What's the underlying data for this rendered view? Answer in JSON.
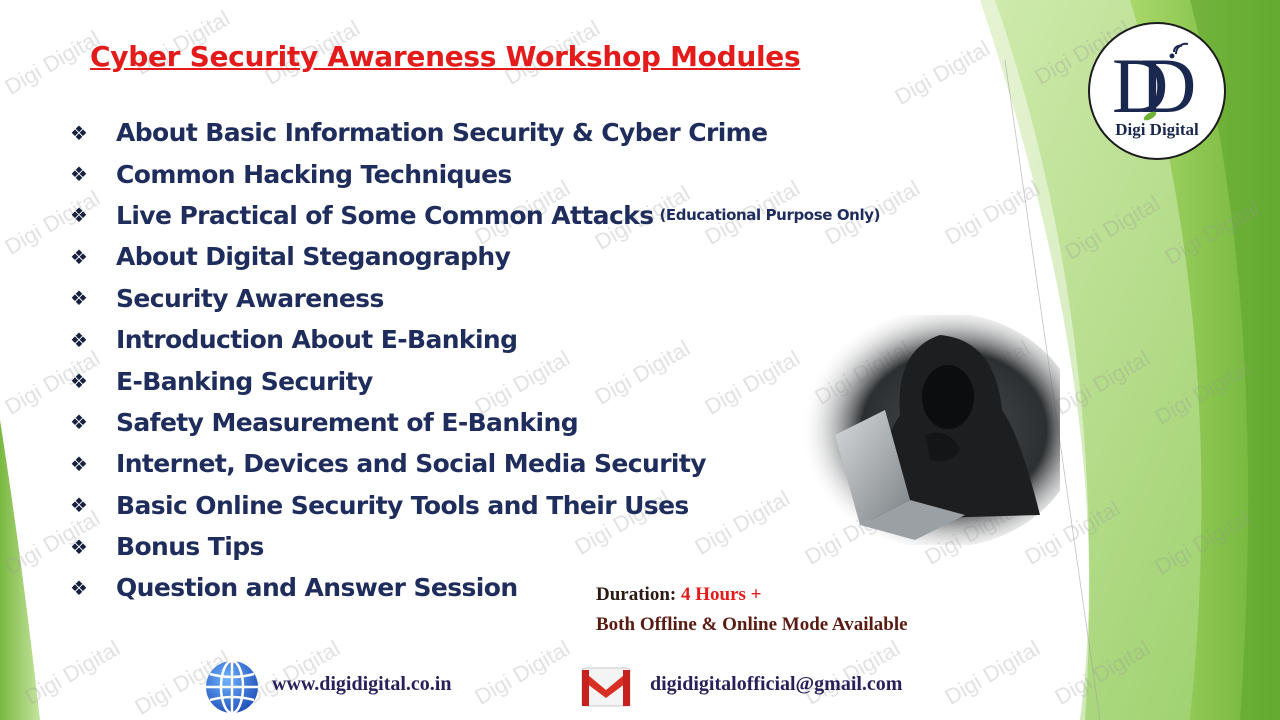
{
  "title": "Cyber Security Awareness Workshop Modules",
  "bullet_glyph": "❖",
  "modules": [
    {
      "text": "About Basic Information Security & Cyber Crime",
      "note": ""
    },
    {
      "text": "Common Hacking Techniques",
      "note": ""
    },
    {
      "text": "Live Practical of Some Common Attacks",
      "note": "(Educational Purpose Only)"
    },
    {
      "text": "About Digital Steganography",
      "note": ""
    },
    {
      "text": "Security Awareness",
      "note": ""
    },
    {
      "text": "Introduction About E-Banking",
      "note": ""
    },
    {
      "text": "E-Banking Security",
      "note": ""
    },
    {
      "text": "Safety Measurement of E-Banking",
      "note": ""
    },
    {
      "text": "Internet, Devices and Social Media Security",
      "note": ""
    },
    {
      "text": "Basic Online Security Tools and Their Uses",
      "note": ""
    },
    {
      "text": "Bonus Tips",
      "note": ""
    },
    {
      "text": "Question and Answer Session",
      "note": ""
    }
  ],
  "duration": {
    "label": "Duration:",
    "value": "4 Hours +",
    "mode": "Both Offline & Online Mode Available"
  },
  "logo": {
    "letters": "DD",
    "text": "Digi Digital"
  },
  "watermark": "Digi Digital",
  "footer": {
    "website": "www.digidigital.co.in",
    "email": "digidigitalofficial@gmail.com"
  },
  "colors": {
    "title": "#e31b1b",
    "module_text": "#1f2d5c",
    "accent_green": "#7cc242",
    "duration_value": "#e31b1b"
  },
  "icons": {
    "website": "globe-icon",
    "email": "gmail-icon",
    "bullet": "diamond-bullet-icon"
  }
}
